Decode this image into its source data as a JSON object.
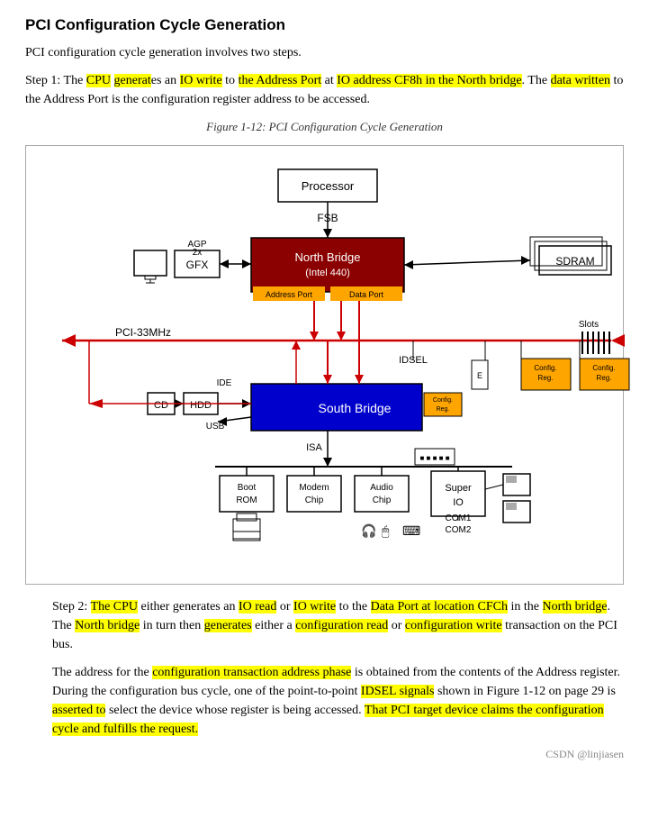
{
  "title": "PCI Configuration Cycle Generation",
  "intro": "PCI configuration cycle generation involves two steps.",
  "step1": {
    "text_parts": [
      {
        "text": "Step 1: The ",
        "highlight": null
      },
      {
        "text": "CPU",
        "highlight": "yellow"
      },
      {
        "text": " generat",
        "highlight": "yellow"
      },
      {
        "text": "es an ",
        "highlight": null
      },
      {
        "text": "IO write",
        "highlight": "yellow"
      },
      {
        "text": " to ",
        "highlight": null
      },
      {
        "text": "the Address Port",
        "highlight": "yellow"
      },
      {
        "text": " at ",
        "highlight": null
      },
      {
        "text": "IO address CF8h",
        "highlight": "yellow"
      },
      {
        "text": "\nin the North bridge",
        "highlight": "yellow"
      },
      {
        "text": ". The ",
        "highlight": null
      },
      {
        "text": "data written",
        "highlight": "yellow"
      },
      {
        "text": " to the Address Port is the configuration register address to be accessed.",
        "highlight": null
      }
    ]
  },
  "figure_caption": "Figure 1-12: PCI Configuration Cycle Generation",
  "step2": {
    "text_parts": [
      {
        "text": "Step 2: ",
        "highlight": null
      },
      {
        "text": "The CPU",
        "highlight": "yellow"
      },
      {
        "text": " either generates an ",
        "highlight": null
      },
      {
        "text": "IO read",
        "highlight": "yellow"
      },
      {
        "text": " or ",
        "highlight": null
      },
      {
        "text": "IO write",
        "highlight": "yellow"
      },
      {
        "text": " to the ",
        "highlight": null
      },
      {
        "text": "Data Port at loca-\ntion CFCh",
        "highlight": "yellow"
      },
      {
        "text": " in the ",
        "highlight": null
      },
      {
        "text": "North bridge",
        "highlight": "yellow"
      },
      {
        "text": ". The ",
        "highlight": null
      },
      {
        "text": "North bridge",
        "highlight": "yellow"
      },
      {
        "text": " in turn then ",
        "highlight": null
      },
      {
        "text": "generates",
        "highlight": "yellow"
      },
      {
        "text": " either a configuration read or ",
        "highlight": null
      },
      {
        "text": "configuration write",
        "highlight": "yellow"
      },
      {
        "text": " transaction on the PCI bus.",
        "highlight": null
      }
    ]
  },
  "para3": {
    "text_parts": [
      {
        "text": "The address for the ",
        "highlight": null
      },
      {
        "text": "configuration transaction address phase",
        "highlight": "yellow"
      },
      {
        "text": " is obtained from the contents of the Address register. During the configuration bus cycle, one of the point-to-point ",
        "highlight": null
      },
      {
        "text": "IDSEL signals",
        "highlight": "yellow"
      },
      {
        "text": " shown in Figure 1-12 on page 29 is ",
        "highlight": null
      },
      {
        "text": "asserted to",
        "highlight": "yellow"
      },
      {
        "text": " select the device whose register is being accessed. ",
        "highlight": null
      },
      {
        "text": "That PCI target device claims\nthe configuration cycle and fulfills the request.",
        "highlight": "yellow"
      }
    ]
  },
  "watermark": "CSDN @linjiasen"
}
